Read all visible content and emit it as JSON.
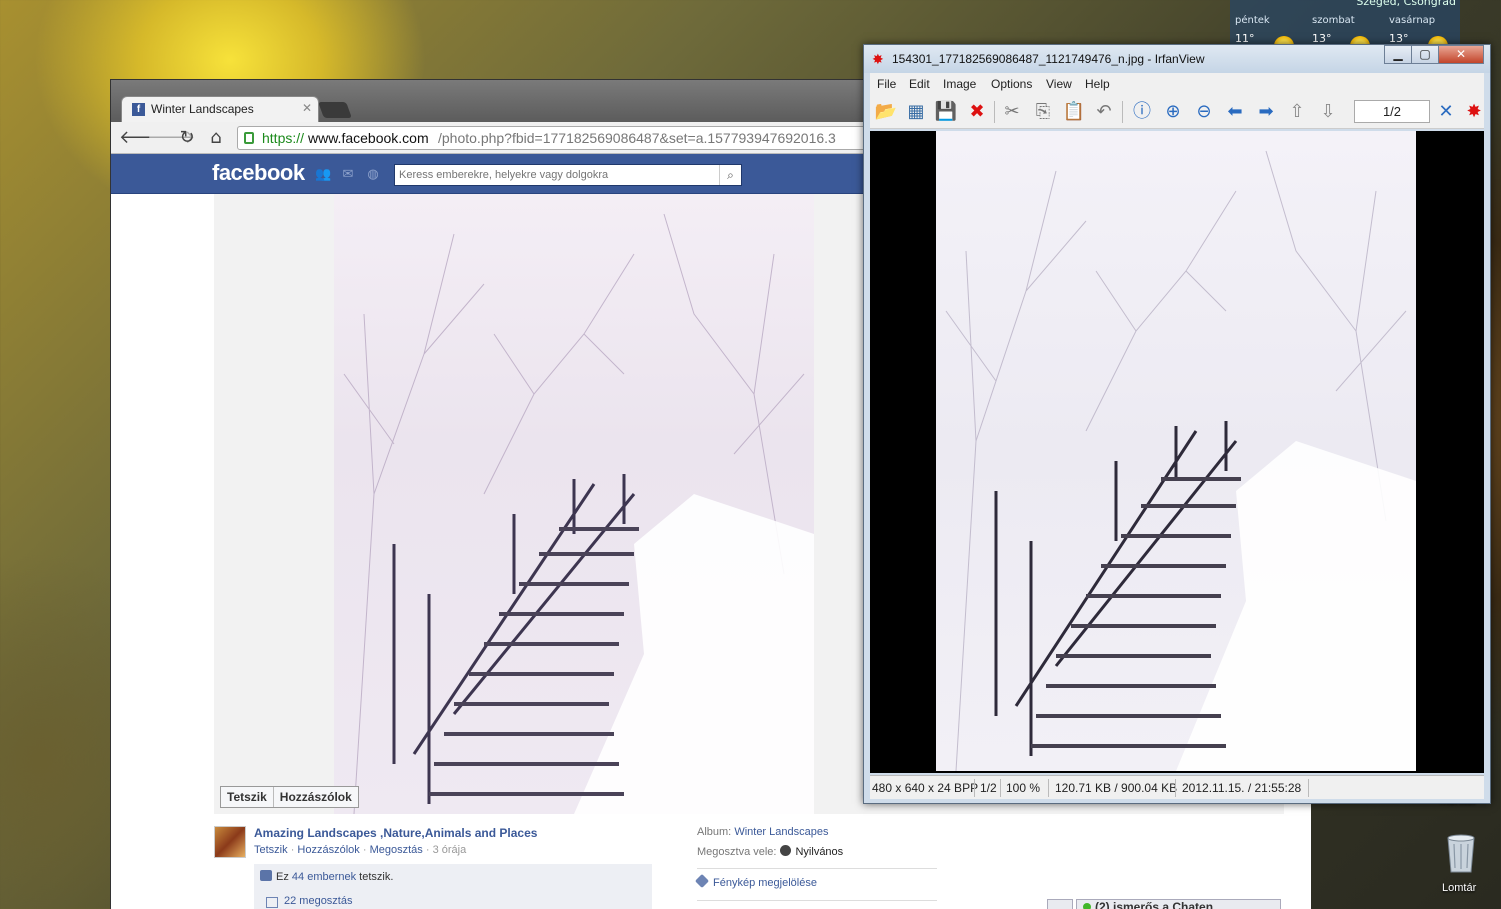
{
  "weather": {
    "location": "Szeged, Csongrád",
    "days": [
      {
        "name": "péntek",
        "temp": "11°"
      },
      {
        "name": "szombat",
        "temp": "13°"
      },
      {
        "name": "vasárnap",
        "temp": "13°"
      }
    ]
  },
  "browser": {
    "tab_title": "Winter Landscapes",
    "url_scheme": "https://",
    "url_domain": "www.facebook.com",
    "url_path": "/photo.php?fbid=177182569086487&set=a.157793947692016.3"
  },
  "facebook": {
    "logo": "facebook",
    "search_placeholder": "Keress emberekre, helyekre vagy dolgokra",
    "photo_buttons": {
      "like": "Tetszik",
      "comment": "Hozzászólok"
    },
    "page_name": "Amazing Landscapes ,Nature,Animals and Places",
    "meta": {
      "like": "Tetszik",
      "comment": "Hozzászólok",
      "share": "Megosztás",
      "time": "3 órája",
      "separator": "·"
    },
    "likes_prefix": "Ez ",
    "likes_link": "44 embernek",
    "likes_suffix": " tetszik.",
    "shares": "22 megosztás",
    "album_label": "Album:",
    "album_name": "Winter Landscapes",
    "shared_label": "Megosztva vele:",
    "shared_value": "Nyilvános",
    "tag_photo": "Fénykép megjelölése",
    "chat": "(2) ismerős a Chaten"
  },
  "irfanview": {
    "title": "154301_177182569086487_1121749476_n.jpg - IrfanView",
    "menu": [
      "File",
      "Edit",
      "Image",
      "Options",
      "View",
      "Help"
    ],
    "page": "1/2",
    "status": {
      "dimensions": "480 x 640 x 24 BPP",
      "page": "1/2",
      "zoom": "100 %",
      "size": "120.71 KB / 900.04 KB",
      "datetime": "2012.11.15. / 21:55:28"
    }
  },
  "desktop": {
    "recycle_bin": "Lomtár",
    "monitor": "monitor"
  }
}
